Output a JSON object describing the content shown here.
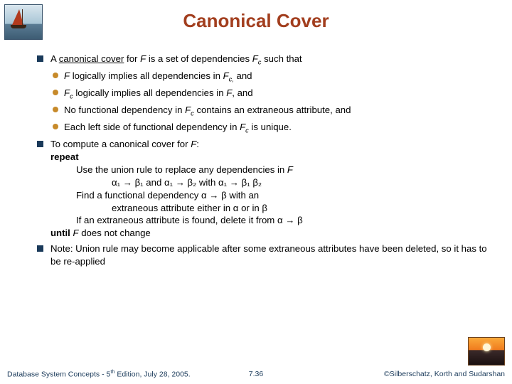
{
  "title": "Canonical Cover",
  "bullets": {
    "b1a_pre": "A ",
    "b1a_under": "canonical cover",
    "b1a_post": " for ",
    "b1a_F": "F",
    "b1a_mid": " is a set of dependencies ",
    "b1a_Fc": "F",
    "b1a_sub": "c",
    "b1a_end": " such that",
    "b2a_F": "F",
    "b2a_text": " logically implies all dependencies in ",
    "b2a_Fc": "F",
    "b2a_sub": "c,",
    "b2a_and": " and",
    "b2b_Fc": "F",
    "b2b_sub": "c",
    "b2b_text": " logically implies all dependencies in ",
    "b2b_F": "F",
    "b2b_end": ", and",
    "b2c_pre": "No functional dependency in ",
    "b2c_Fc": "F",
    "b2c_sub": "c",
    "b2c_end": " contains an extraneous attribute, and",
    "b2d_pre": "Each left side of functional dependency in ",
    "b2d_Fc": "F",
    "b2d_sub": "c",
    "b2d_end": " is unique.",
    "b1b_pre": "To compute a canonical cover for ",
    "b1b_F": "F",
    "b1b_colon": ":",
    "algo_repeat": "repeat",
    "algo_l1": "Use the union rule to replace any dependencies in ",
    "algo_l1_F": "F",
    "algo_l2": "α₁ → β₁ and α₁ → β₂ with α₁ → β₁ β₂",
    "algo_l3": "Find a functional dependency α → β with an",
    "algo_l4": "extraneous attribute either in α or in β",
    "algo_l5": "If an extraneous attribute is found, delete it from α → β",
    "algo_until_pre": "until ",
    "algo_until_F": "F",
    "algo_until_post": " does not change",
    "b1c": "Note: Union rule may become applicable after some extraneous attributes have been deleted, so it has to be re-applied"
  },
  "footer": {
    "left_pre": "Database System Concepts - 5",
    "left_sup": "th",
    "left_post": " Edition, July 28, 2005.",
    "center": "7.36",
    "right": "©Silberschatz, Korth and Sudarshan"
  }
}
